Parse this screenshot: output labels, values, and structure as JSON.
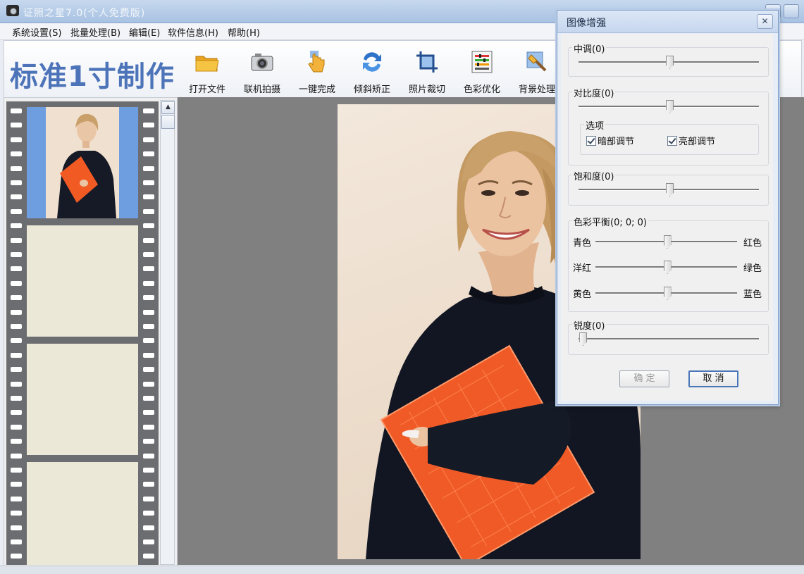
{
  "window": {
    "title": "证照之星7.0(个人免费版)"
  },
  "menu": [
    {
      "label": "系统设置(S)"
    },
    {
      "label": "批量处理(B)"
    },
    {
      "label": "编辑(E)"
    },
    {
      "label": "软件信息(H)"
    },
    {
      "label": "帮助(H)"
    }
  ],
  "toolbar": {
    "brand": "标准1寸制作",
    "tools": [
      {
        "label": "打开文件",
        "icon": "folder-icon"
      },
      {
        "label": "联机拍摄",
        "icon": "camera-icon"
      },
      {
        "label": "一键完成",
        "icon": "hand-pointer-icon"
      },
      {
        "label": "倾斜矫正",
        "icon": "rotate-arrows-icon"
      },
      {
        "label": "照片裁切",
        "icon": "crop-icon"
      },
      {
        "label": "色彩优化",
        "icon": "color-levels-icon"
      },
      {
        "label": "背景处理",
        "icon": "brush-icon"
      }
    ]
  },
  "dialog": {
    "title": "图像增强",
    "close_symbol": "✕",
    "midtone": {
      "label": "中调(0)",
      "value": 0,
      "range": [
        -100,
        100
      ]
    },
    "contrast": {
      "label": "对比度(0)",
      "value": 0,
      "range": [
        -100,
        100
      ]
    },
    "options": {
      "label": "选项",
      "dark_adjust": {
        "label": "暗部调节",
        "checked": true
      },
      "bright_adjust": {
        "label": "亮部调节",
        "checked": true
      }
    },
    "saturation": {
      "label": "饱和度(0)",
      "value": 0,
      "range": [
        -100,
        100
      ]
    },
    "color_balance": {
      "label": "色彩平衡(0; 0; 0)",
      "rows": [
        {
          "left": "青色",
          "right": "红色",
          "value": 0
        },
        {
          "left": "洋红",
          "right": "绿色",
          "value": 0
        },
        {
          "left": "黄色",
          "right": "蓝色",
          "value": 0
        }
      ],
      "range": [
        -100,
        100
      ]
    },
    "sharpness": {
      "label": "锐度(0)",
      "value": 0,
      "range": [
        0,
        100
      ]
    },
    "ok_label": "确 定",
    "cancel_label": "取 消"
  }
}
